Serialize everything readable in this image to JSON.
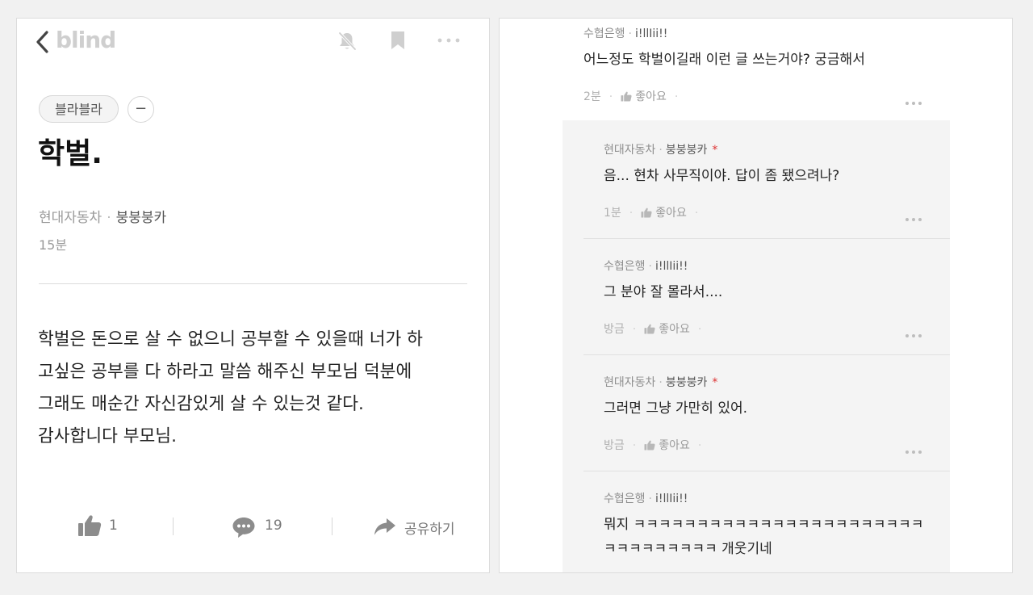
{
  "header": {
    "logo": "blind",
    "icons": [
      "chevron-left-icon",
      "bell-off-icon",
      "bookmark-icon",
      "more-icon"
    ]
  },
  "post": {
    "topic": "블라블라",
    "topic_toggle": "−",
    "title": "학벌.",
    "company": "현대자동차",
    "separator": "·",
    "nickname": "붕붕붕카",
    "time": "15분",
    "body_lines": [
      "학벌은 돈으로 살 수 없으니 공부할 수 있을때 너가 하",
      "고싶은 공부를 다 하라고 말씀 해주신 부모님 덕분에",
      "그래도 매순간 자신감있게 살 수 있는것 같다.",
      "감사합니다 부모님."
    ],
    "likes": "1",
    "comments": "19",
    "share": "공유하기"
  },
  "comments": [
    {
      "company": "수협은행",
      "nickname": "i!llIii!!",
      "op": false,
      "lines": [
        "어느정도 학벌이길래 이런 글 쓰는거야? 궁금해서"
      ],
      "time": "2분",
      "like_label": "좋아요",
      "reply": false
    },
    {
      "company": "현대자동차",
      "nickname": "붕붕붕카",
      "op": true,
      "op_mark": "*",
      "lines": [
        "음... 현차 사무직이야. 답이 좀 됐으려나?"
      ],
      "time": "1분",
      "like_label": "좋아요",
      "reply": true
    },
    {
      "company": "수협은행",
      "nickname": "i!llIii!!",
      "op": false,
      "lines": [
        "그 분야 잘 몰라서...."
      ],
      "time": "방금",
      "like_label": "좋아요",
      "reply": true
    },
    {
      "company": "현대자동차",
      "nickname": "붕붕붕카",
      "op": true,
      "op_mark": "*",
      "lines": [
        "그러면 그냥 가만히 있어."
      ],
      "time": "방금",
      "like_label": "좋아요",
      "reply": true
    },
    {
      "company": "수협은행",
      "nickname": "i!llIii!!",
      "op": false,
      "lines": [
        "뭐지 ㅋㅋㅋㅋㅋㅋㅋㅋㅋㅋㅋㅋㅋㅋㅋㅋㅋㅋㅋㅋㅋㅋㅋ",
        "ㅋㅋㅋㅋㅋㅋㅋㅋㅋ 개웃기네"
      ],
      "time": "",
      "like_label": "",
      "reply": true
    }
  ]
}
